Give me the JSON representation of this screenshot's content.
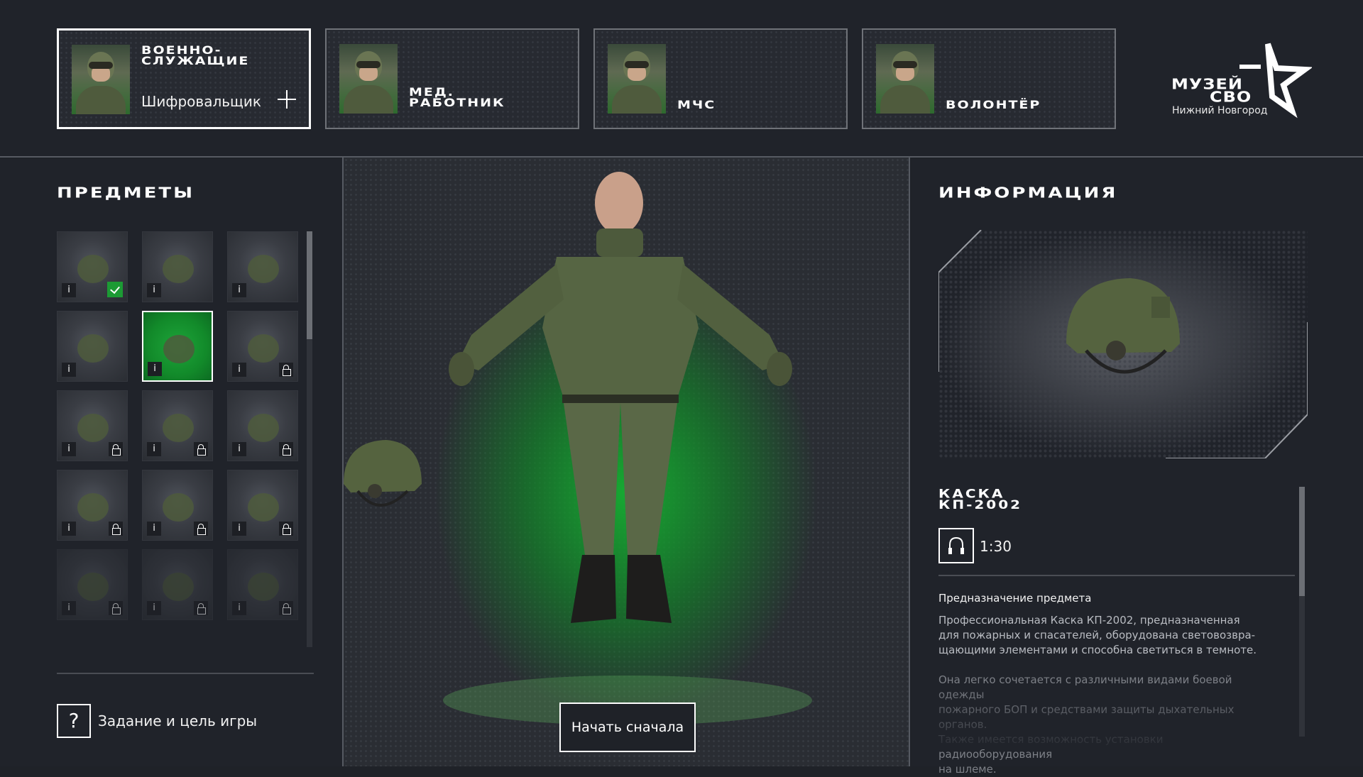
{
  "header": {
    "roles": [
      {
        "title_line1": "ВОЕННО-",
        "title_line2": "СЛУЖАЩИЕ",
        "subtitle": "Шифровальщик",
        "active": true
      },
      {
        "title_line1": "МЕД.",
        "title_line2": "РАБОТНИК",
        "active": false
      },
      {
        "title_line1": "",
        "title_line2": "МЧС",
        "active": false
      },
      {
        "title_line1": "",
        "title_line2": "ВОЛОНТЁР",
        "active": false
      }
    ],
    "logo": {
      "line1": "МУЗЕЙ",
      "line2": "СВО",
      "city": "Нижний Новгород"
    }
  },
  "left": {
    "title": "ПРЕДМЕТЫ",
    "items": [
      {
        "icon": "uniform-icon",
        "status": "equipped"
      },
      {
        "icon": "gloves-icon",
        "status": "available"
      },
      {
        "icon": "vest-icon",
        "status": "available"
      },
      {
        "icon": "belt-icon",
        "status": "available"
      },
      {
        "icon": "helmet-icon",
        "status": "selected"
      },
      {
        "icon": "goggles-icon",
        "status": "locked"
      },
      {
        "icon": "radio-icon",
        "status": "locked"
      },
      {
        "icon": "rifle-icon",
        "status": "locked"
      },
      {
        "icon": "goggles-icon",
        "status": "locked"
      },
      {
        "icon": "radio-icon",
        "status": "locked"
      },
      {
        "icon": "rifle-icon",
        "status": "locked"
      },
      {
        "icon": "goggles-icon",
        "status": "locked"
      },
      {
        "icon": "radio-icon",
        "status": "locked"
      },
      {
        "icon": "rifle-icon",
        "status": "locked"
      },
      {
        "icon": "goggles-icon",
        "status": "locked"
      }
    ],
    "info_label": "i",
    "help_button": "?",
    "help_label": "Задание и цель игры"
  },
  "center": {
    "restart_label": "Начать сначала"
  },
  "right": {
    "title": "ИНФОРМАЦИЯ",
    "item_name_line1": "КАСКА",
    "item_name_line2": "КП-2002",
    "audio_time": "1:30",
    "purpose_title": "Предназначение предмета",
    "desc_lines_1": [
      "Профессиональная Каска КП-2002, предназначенная",
      "для пожарных и спасателей, оборудована световозвра-",
      "щающими элементами и способна светиться в темноте."
    ],
    "desc_lines_2": [
      "Она легко сочетается с различными видами боевой одежды",
      "пожарного БОП и средствами защиты дыхательных органов.",
      "Также имеется возможность установки радиооборудования",
      "на шлеме."
    ]
  },
  "colors": {
    "accent_green": "#1ea53a",
    "background": "#20232a",
    "border": "#565a62"
  }
}
